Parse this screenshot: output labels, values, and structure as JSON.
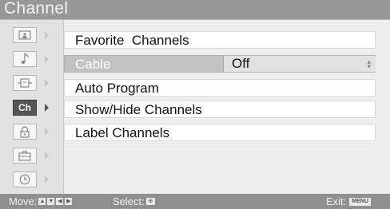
{
  "title": "Channel",
  "sidebar": {
    "items": [
      {
        "name": "picture",
        "icon": "picture-icon",
        "glyph": "▣",
        "active": false
      },
      {
        "name": "sound",
        "icon": "music-note-icon",
        "glyph": "♪",
        "active": false
      },
      {
        "name": "screen",
        "icon": "screen-icon",
        "glyph": "⊟",
        "active": false
      },
      {
        "name": "channel",
        "icon": "channel-icon",
        "glyph": "Ch",
        "active": true
      },
      {
        "name": "parental-lock",
        "icon": "lock-icon",
        "glyph": "🔒",
        "active": false
      },
      {
        "name": "setup",
        "icon": "toolbox-icon",
        "glyph": "⊞",
        "active": false
      },
      {
        "name": "timer",
        "icon": "clock-icon",
        "glyph": "◷",
        "active": false
      }
    ]
  },
  "menu": {
    "items": [
      {
        "label": "Favorite  Channels",
        "value": null,
        "selected": false
      },
      {
        "label": "Cable",
        "value": "Off",
        "selected": true
      },
      {
        "label": "Auto Program",
        "value": null,
        "selected": false
      },
      {
        "label": "Show/Hide Channels",
        "value": null,
        "selected": false
      },
      {
        "label": "Label Channels",
        "value": null,
        "selected": false
      }
    ]
  },
  "footer": {
    "move_label": "Move:",
    "select_label": "Select:",
    "exit_label": "Exit:",
    "exit_key": "MENU"
  },
  "colors": {
    "title_bar": "#989898",
    "selected_row": "#c2c2c2",
    "active_sidebar": "#555555"
  }
}
